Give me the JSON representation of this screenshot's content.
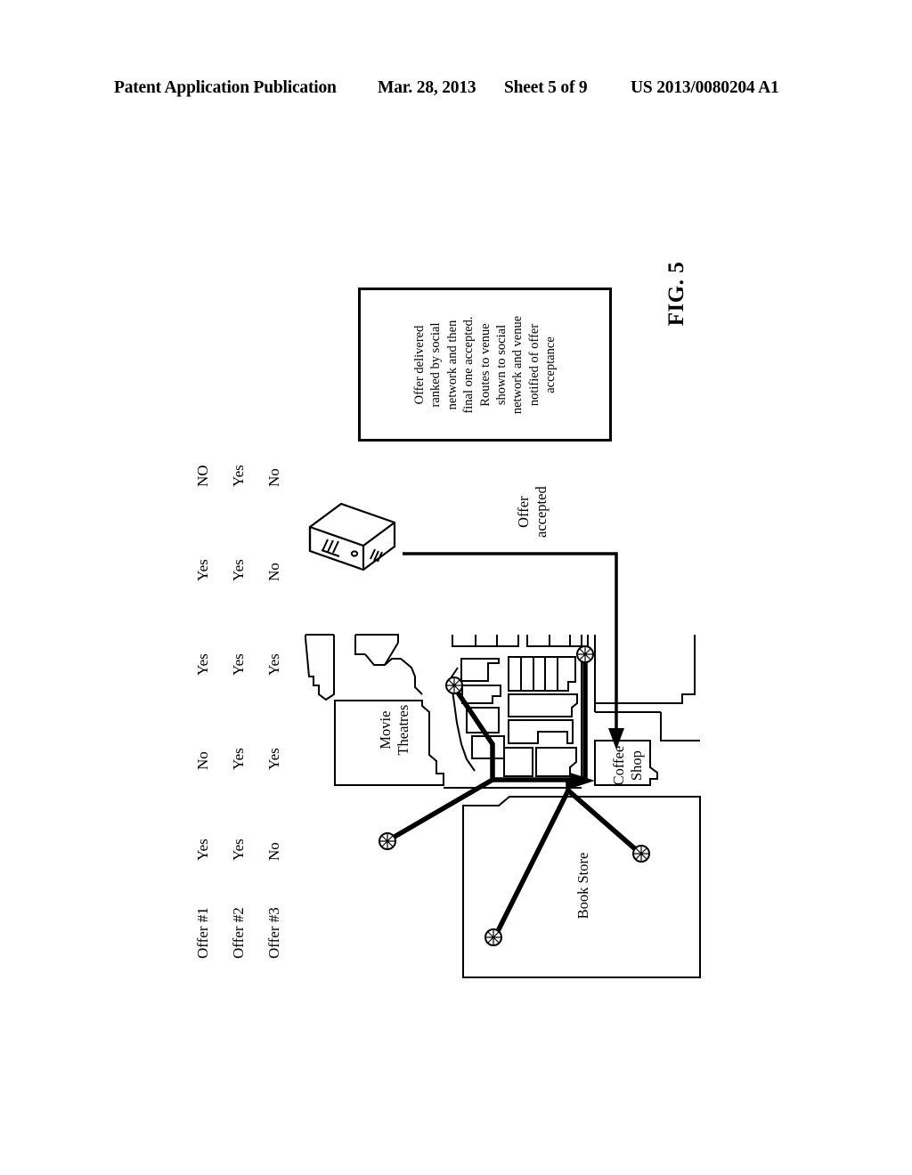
{
  "header": {
    "publication": "Patent Application Publication",
    "date": "Mar. 28, 2013",
    "sheet": "Sheet 5 of 9",
    "patent_number": "US 2013/0080204 A1"
  },
  "figure": {
    "caption": "FIG. 5"
  },
  "annotation": {
    "text": "Offer delivered\nranked by social\nnetwork and then\nfinal one accepted.\nRoutes to venue\nshown to social\nnetwork and venue\nnotified of offer\nacceptance"
  },
  "offer_table": {
    "rows": [
      {
        "label": "Offer #1",
        "values": [
          "Yes",
          "No",
          "Yes",
          "Yes",
          "NO"
        ]
      },
      {
        "label": "Offer #2",
        "values": [
          "Yes",
          "Yes",
          "Yes",
          "Yes",
          "Yes"
        ]
      },
      {
        "label": "Offer #3",
        "values": [
          "No",
          "Yes",
          "Yes",
          "No",
          "No"
        ]
      }
    ]
  },
  "map": {
    "labels": {
      "movie_theatres": "Movie\nTheatres",
      "coffee_shop": "Coffee\nShop",
      "book_store": "Book Store",
      "offer_accepted": "Offer\naccepted"
    }
  },
  "colors": {
    "ink": "#000000",
    "paper": "#ffffff"
  }
}
